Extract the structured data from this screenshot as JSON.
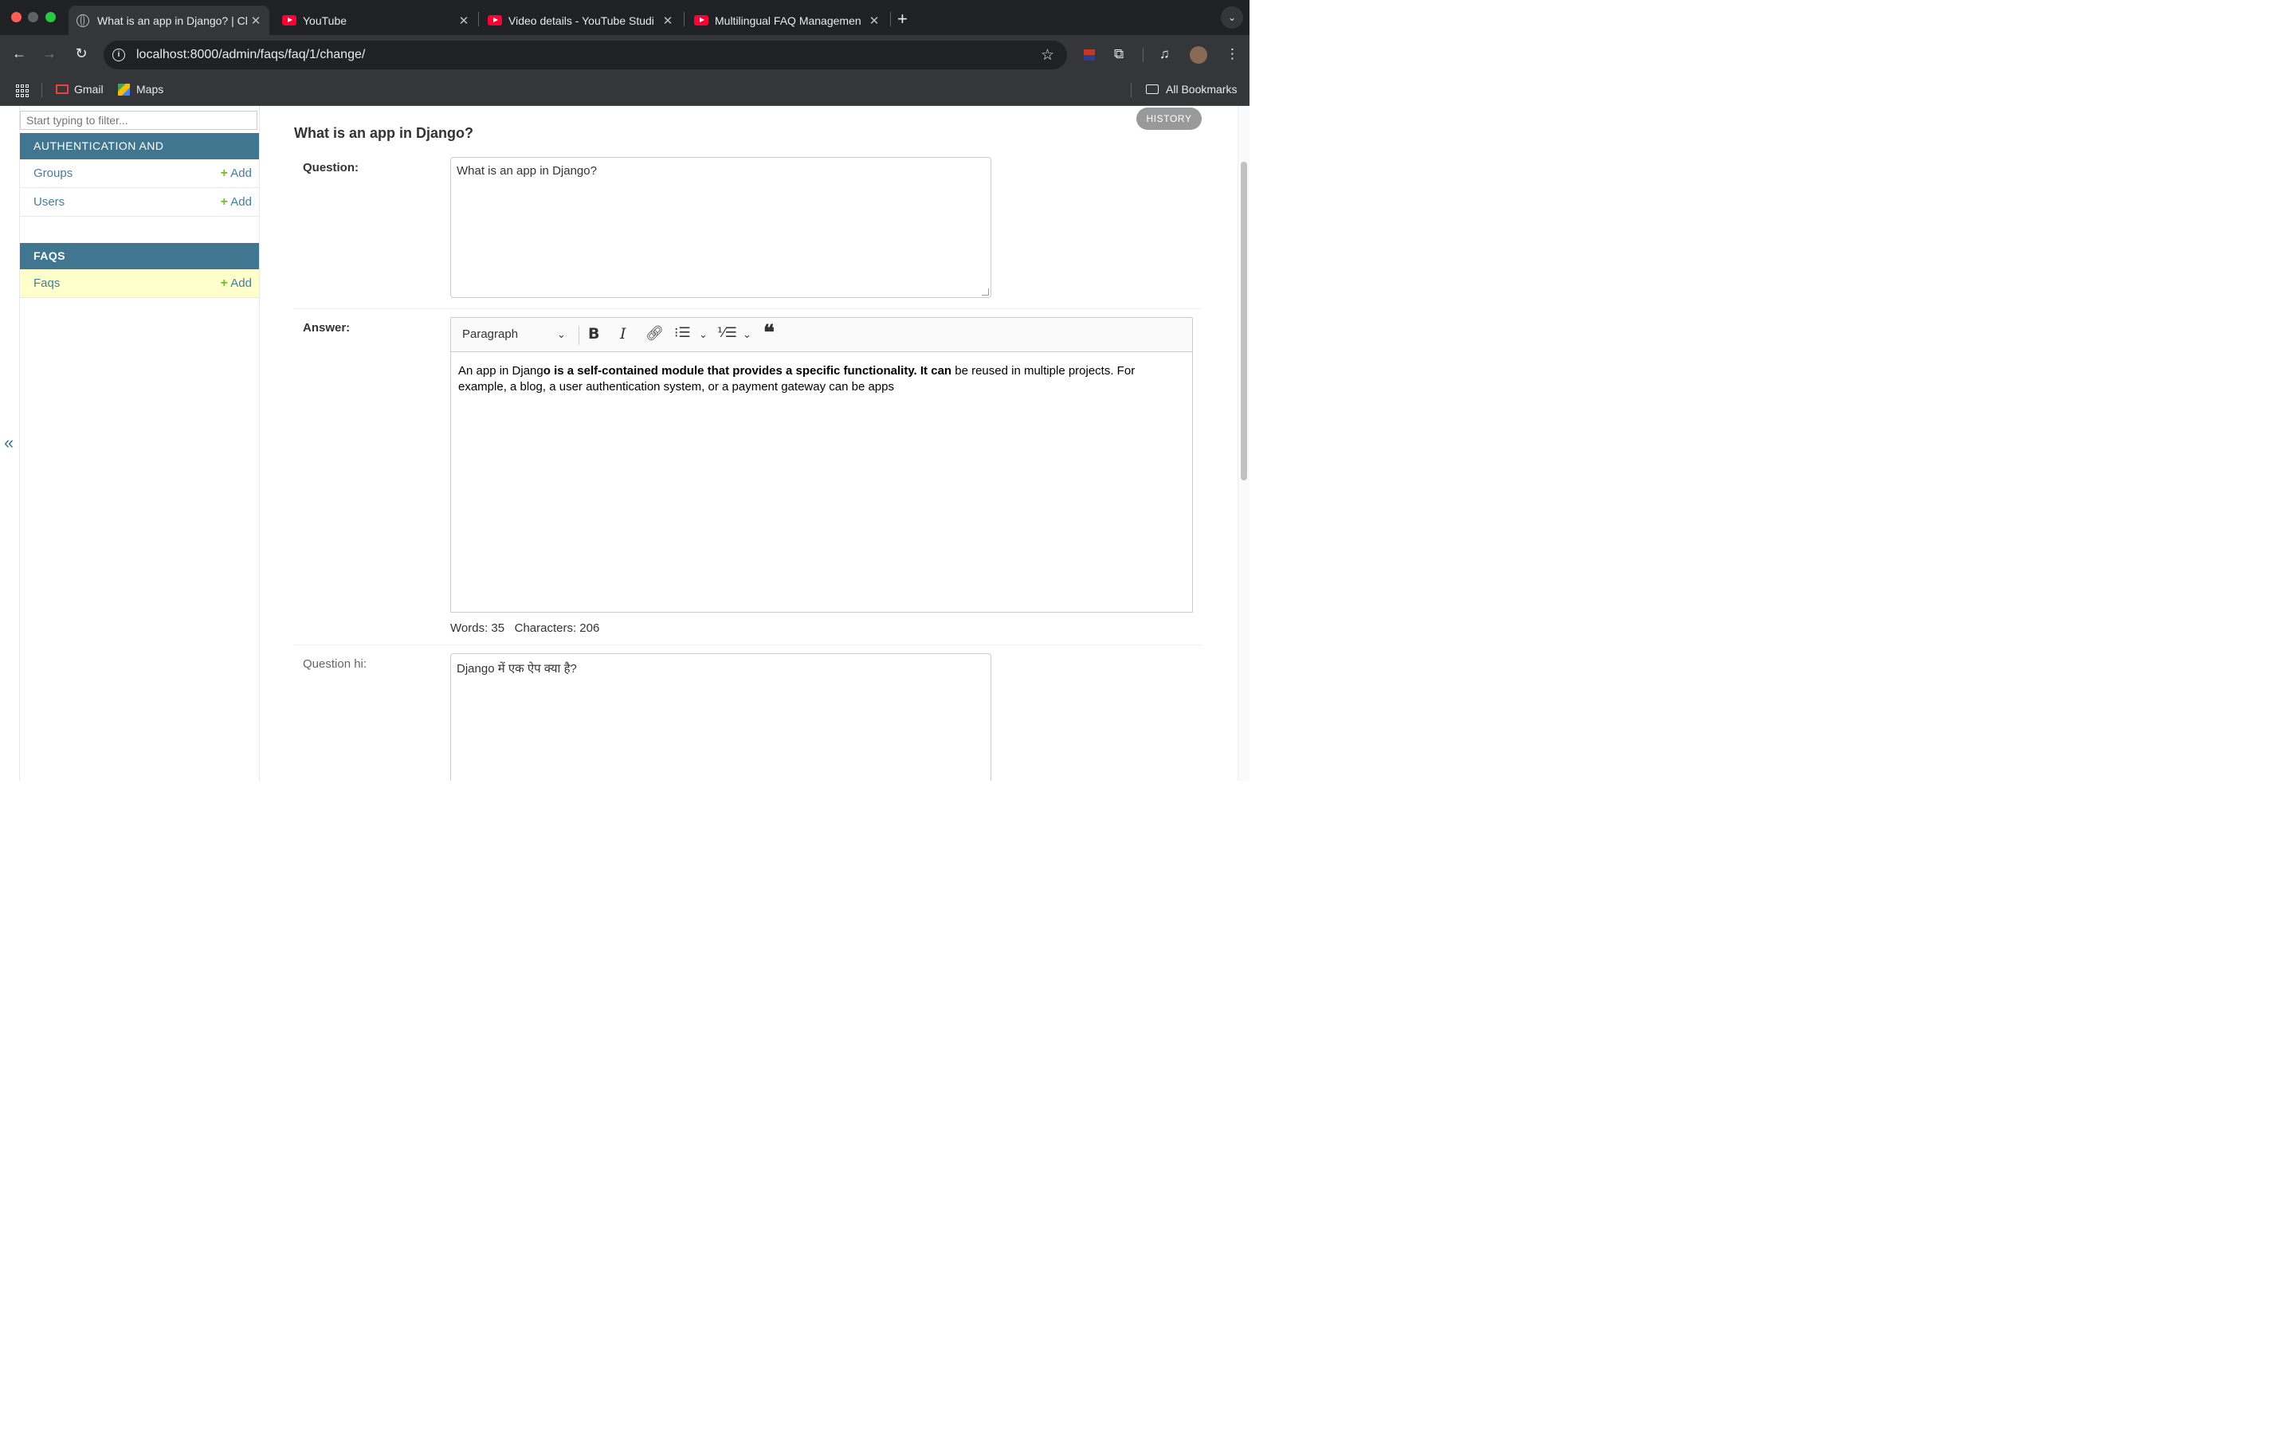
{
  "browser": {
    "tabs": [
      {
        "title": "What is an app in Django? | Cl",
        "icon": "globe-icon",
        "active": true
      },
      {
        "title": "YouTube",
        "icon": "youtube-icon",
        "active": false
      },
      {
        "title": "Video details - YouTube Studi",
        "icon": "youtube-icon",
        "active": false
      },
      {
        "title": "Multilingual FAQ Managemen",
        "icon": "youtube-icon",
        "active": false
      }
    ],
    "close_glyph": "✕",
    "new_tab_glyph": "+",
    "url": "localhost:8000/admin/faqs/faq/1/change/",
    "bookmarks": {
      "gmail": "Gmail",
      "maps": "Maps",
      "all": "All Bookmarks"
    }
  },
  "sidebar": {
    "filter_placeholder": "Start typing to filter...",
    "collapse_glyph": "«",
    "modules": [
      {
        "title": "AUTHENTICATION AND AUTHORIZATION",
        "models": [
          {
            "name": "Groups",
            "add": "Add"
          },
          {
            "name": "Users",
            "add": "Add"
          }
        ]
      },
      {
        "title": "FAQS",
        "models": [
          {
            "name": "Faqs",
            "add": "Add"
          }
        ]
      }
    ]
  },
  "main": {
    "history_label": "HISTORY",
    "object_title": "What is an app in Django?",
    "question": {
      "label": "Question:",
      "value": "What is an app in Django?"
    },
    "answer": {
      "label": "Answer:",
      "paragraph_select": "Paragraph",
      "text_normal_1": "An app in Djang",
      "text_bold": "o is a self-contained module that provides a specific functionality. It can",
      "text_normal_2": " be reused in multiple projects. For example, a blog, a user authentication system, or a payment gateway can be apps",
      "words_label": "Words: 35",
      "characters_label": "Characters: 206"
    },
    "question_hi": {
      "label": "Question hi:",
      "value": "Django में एक ऐप क्या है?"
    }
  },
  "colors": {
    "module_header": "#417690",
    "link": "#447e9b",
    "add_plus": "#70bf2b",
    "current_row": "#ffffcc",
    "browser_dark": "#202124"
  }
}
